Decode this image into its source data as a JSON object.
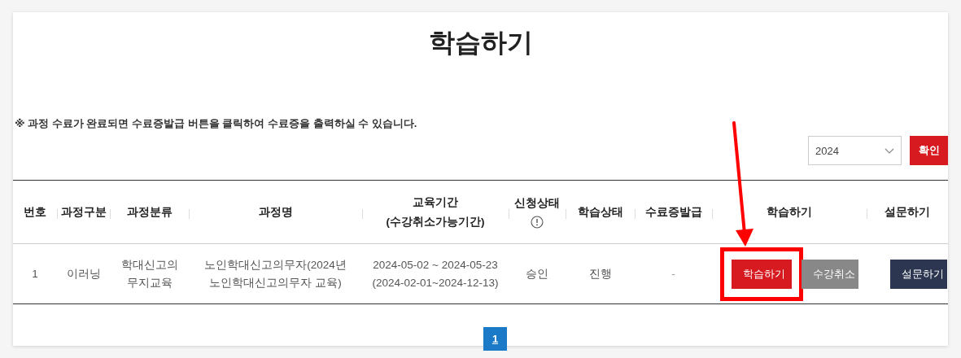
{
  "title": "학습하기",
  "notice": "※ 과정 수료가 완료되면 수료증발급 버튼을 클릭하여 수료증을 출력하실 수 있습니다.",
  "year_select": {
    "value": "2024"
  },
  "confirm_button": "확인",
  "table": {
    "columns": [
      {
        "label": "번호"
      },
      {
        "label": "과정구분"
      },
      {
        "label": "과정분류"
      },
      {
        "label": "과정명"
      },
      {
        "label": "교육기간",
        "sublabel": "(수강취소가능기간)"
      },
      {
        "label": "신청상태",
        "info_icon": true
      },
      {
        "label": "학습상태"
      },
      {
        "label": "수료증발급"
      },
      {
        "label": "학습하기"
      },
      {
        "label": "설문하기"
      }
    ],
    "rows": [
      {
        "number": "1",
        "type": "이러닝",
        "category": "학대신고의 무지교육",
        "name": "노인학대신고의무자(2024년 노인학대신고의무자 교육)",
        "period": "2024-05-02 ~ 2024-05-23",
        "cancel_period": "(2024-02-01~2024-12-13)",
        "apply_status": "승인",
        "learn_status": "진행",
        "certificate": "-",
        "actions": [
          {
            "label": "학습하기",
            "kind": "primary",
            "highlighted": true
          },
          {
            "label": "수강취소",
            "kind": "secondary",
            "highlighted": false
          }
        ],
        "survey_button": "설문하기"
      }
    ]
  },
  "pagination": [
    {
      "label": "1",
      "selected": true
    }
  ]
}
